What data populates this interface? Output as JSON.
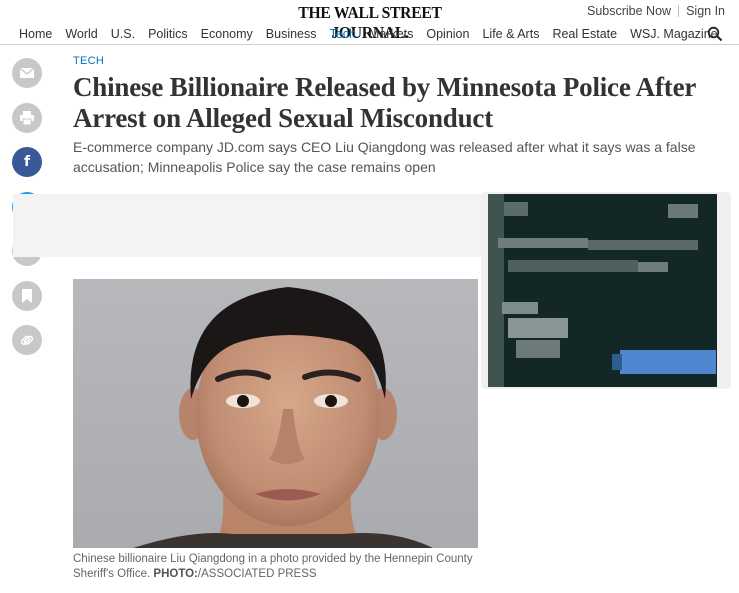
{
  "header": {
    "logo_text": "THE WALL STREET JOURNAL.",
    "subscribe_label": "Subscribe Now",
    "signin_label": "Sign In"
  },
  "nav": {
    "items": [
      "Home",
      "World",
      "U.S.",
      "Politics",
      "Economy",
      "Business",
      "Tech",
      "Markets",
      "Opinion",
      "Life & Arts",
      "Real Estate",
      "WSJ. Magazine"
    ],
    "active": "Tech"
  },
  "share_rail": {
    "buttons": [
      "email-icon",
      "print-icon",
      "facebook-icon",
      "twitter-icon",
      "text-size-icon",
      "bookmark-icon",
      "permalink-icon"
    ]
  },
  "article": {
    "section": "TECH",
    "headline": "Chinese Billionaire Released by Minnesota Police After Arrest on Alleged Sexual Misconduct",
    "dek": "E-commerce company JD.com says CEO Liu Qiangdong was released after what it says was a false accusation; Minneapolis Police say the case remains open",
    "caption_text": "Chinese billionaire Liu Qiangdong in a photo provided by the Hennepin County Sheriff's Office.",
    "caption_credit_label": "PHOTO:",
    "caption_credit": "/ASSOCIATED PRESS"
  },
  "colors": {
    "accent": "#0274b6",
    "facebook": "#3b5998",
    "twitter": "#1da1f2",
    "ad_background": "#132826"
  }
}
